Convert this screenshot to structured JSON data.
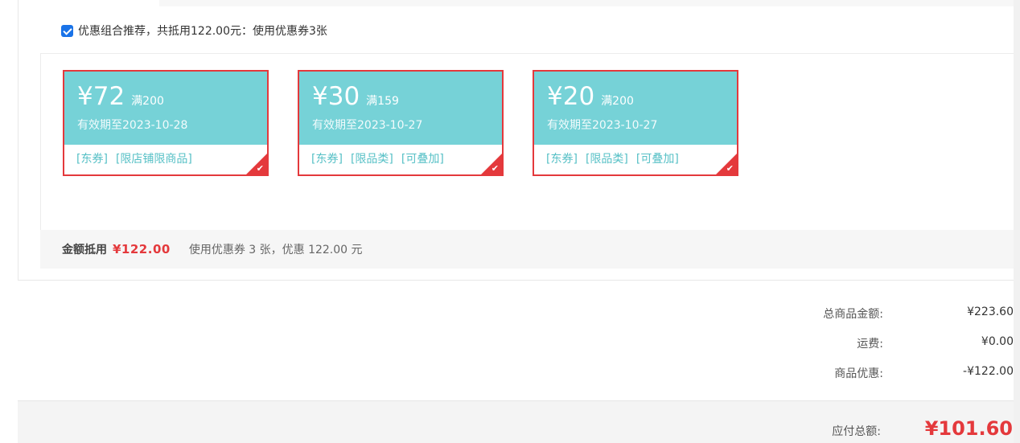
{
  "recommend": {
    "checked": true,
    "text": "优惠组合推荐，共抵用122.00元：使用优惠券3张"
  },
  "coupons": [
    {
      "amount": "¥72",
      "condition": "满200",
      "validity": "有效期至2023-10-28",
      "tags": [
        "[东券]",
        "[限店铺限商品]"
      ]
    },
    {
      "amount": "¥30",
      "condition": "满159",
      "validity": "有效期至2023-10-27",
      "tags": [
        "[东券]",
        "[限品类]",
        "[可叠加]"
      ]
    },
    {
      "amount": "¥20",
      "condition": "满200",
      "validity": "有效期至2023-10-27",
      "tags": [
        "[东券]",
        "[限品类]",
        "[可叠加]"
      ]
    }
  ],
  "summary": {
    "label": "金额抵用",
    "amount": "¥122.00",
    "desc": "使用优惠券 3 张，优惠 122.00 元"
  },
  "fees": [
    {
      "label": "总商品金额:",
      "value": "¥223.60"
    },
    {
      "label": "运费:",
      "value": "¥0.00"
    },
    {
      "label": "商品优惠:",
      "value": "-¥122.00"
    }
  ],
  "total": {
    "label": "应付总额:",
    "amount": "¥101.60"
  },
  "colors": {
    "accent_red": "#e4393c",
    "coupon_teal": "#76d2d7",
    "tag_teal": "#56c0c6",
    "checkbox_blue": "#1a73e8"
  },
  "icons": {
    "checkbox": "checkbox-checked-icon",
    "selected_corner": "checkmark-icon"
  }
}
